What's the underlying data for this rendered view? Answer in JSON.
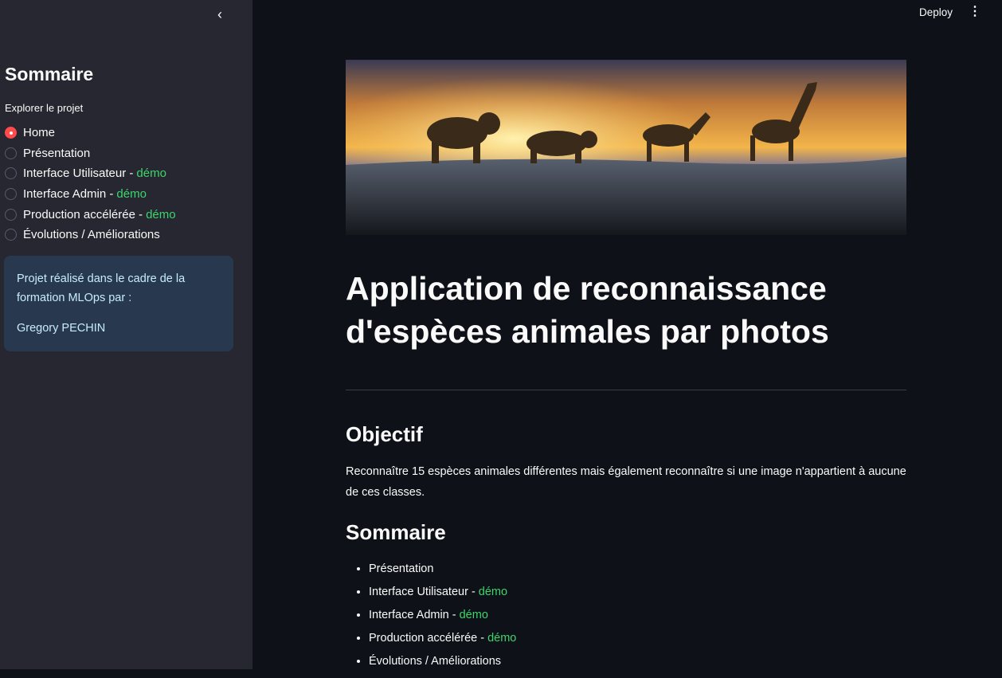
{
  "sidebar": {
    "title": "Sommaire",
    "radio_label": "Explorer le projet",
    "options": [
      {
        "label": "Home",
        "suffix": ""
      },
      {
        "label": "Présentation",
        "suffix": ""
      },
      {
        "label": "Interface Utilisateur -",
        "suffix": "démo"
      },
      {
        "label": "Interface Admin -",
        "suffix": "démo"
      },
      {
        "label": "Production accélérée -",
        "suffix": "démo"
      },
      {
        "label": "Évolutions / Améliorations",
        "suffix": ""
      }
    ],
    "selected": "Home",
    "info": {
      "line1": "Projet réalisé dans le cadre de la formation MLOps par :",
      "line2": "Gregory PECHIN"
    }
  },
  "header": {
    "deploy": "Deploy"
  },
  "main": {
    "title": "Application de reconnaissance d'espèces animales par photos",
    "objectif_heading": "Objectif",
    "objectif_text": "Reconnaître 15 espèces animales différentes mais également reconnaître si une image n'appartient à aucune de ces classes.",
    "sommaire_heading": "Sommaire",
    "items": [
      {
        "label": "Présentation",
        "suffix": ""
      },
      {
        "label": "Interface Utilisateur -",
        "suffix": "démo"
      },
      {
        "label": "Interface Admin -",
        "suffix": "démo"
      },
      {
        "label": "Production accélérée -",
        "suffix": "démo"
      },
      {
        "label": "Évolutions / Améliorations",
        "suffix": ""
      }
    ]
  },
  "colors": {
    "accent": "#ff4b4b",
    "demo": "#3dd56d",
    "info_bg": "#28394f"
  }
}
